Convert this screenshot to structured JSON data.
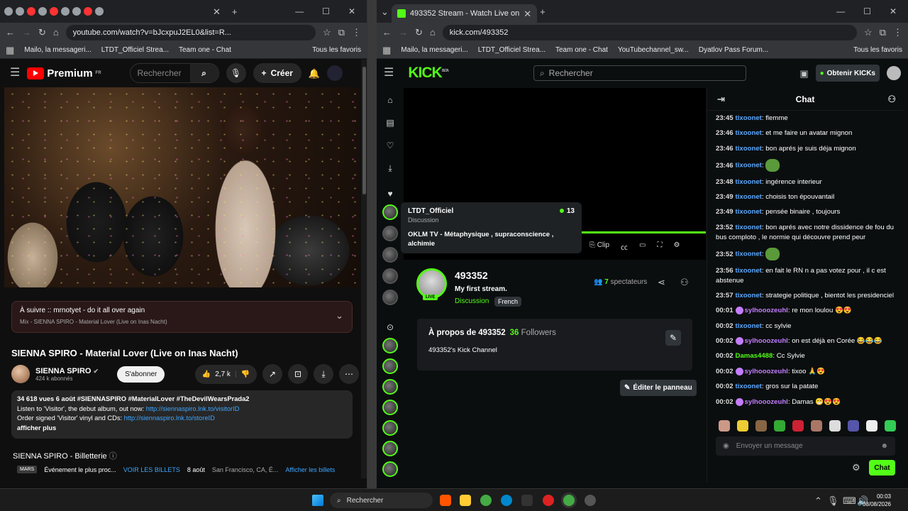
{
  "left": {
    "url": "youtube.com/watch?v=bJcxpuJ2EL0&list=R...",
    "bookmarks": [
      "Mailo, la messageri...",
      "LTDT_Officiel Strea...",
      "Team one - Chat",
      "Tous les favoris"
    ],
    "yt": {
      "logo": "Premium",
      "logo_region": "FR",
      "search_placeholder": "Rechercher",
      "create_label": "Créer",
      "next_title": "À suivre :: mrnotyet - do it all over again",
      "next_sub": "Mix - SIENNA SPIRO - Material Lover (Live on Inas Nacht)",
      "video_title": "SIENNA SPIRO - Material Lover (Live on Inas Nacht)",
      "channel": "SIENNA SPIRO",
      "subs": "424 k abonnés",
      "subscribe": "S'abonner",
      "likes": "2,7 k",
      "desc_meta": "34 618 vues  6 août  #SIENNASPIRO #MaterialLover #TheDevilWearsPrada2",
      "desc_l1": "Listen to 'Visitor', the debut album, out now: ",
      "desc_l1_link": "http://siennaspiro.lnk.to/visitorID",
      "desc_l2": "Order signed 'Visitor' vinyl and CDs: ",
      "desc_l2_link": "http://siennaspiro.lnk.to/storeID",
      "desc_more": "afficher plus",
      "tickets_heading": "SIENNA SPIRO - Billetterie",
      "ticket_month": "MARS",
      "ticket_event": "Événement le plus proc...",
      "ticket_link": "VOIR LES BILLETS",
      "ticket_date": "8 août",
      "ticket_place": "San Francisco, CA, É...",
      "ticket_all": "Afficher les billets"
    }
  },
  "right": {
    "tab_title": "493352 Stream - Watch Live on",
    "url": "kick.com/493352",
    "bookmarks": [
      "Mailo, la messageri...",
      "LTDT_Officiel Strea...",
      "Team one - Chat",
      "YouTubechannel_sw...",
      "Dyatlov Pass Forum...",
      "Tous les favoris"
    ],
    "kick": {
      "logo": "KICK",
      "logo_badge": "BETA",
      "search_placeholder": "Rechercher",
      "get_kicks": "Obtenir KICKs",
      "tooltip": {
        "name": "LTDT_Officiel",
        "category": "Discussion",
        "viewers": "13",
        "title": "OKLM TV - Métaphysique , supraconscience , alchimie"
      },
      "controls": {
        "clip": "Clip"
      },
      "channel": "493352",
      "live": "LIVE",
      "stream_title": "My first stream.",
      "category": "Discussion",
      "language": "French",
      "viewers_count": "7",
      "viewers_label": "spectateurs",
      "about_prefix": "À propos de 493352",
      "followers_count": "36",
      "followers_label": "Followers",
      "about_desc": "493352's Kick Channel",
      "edit_panel": "Éditer le panneau",
      "chat_title": "Chat",
      "chat_placeholder": "Envoyer un message",
      "chat_button": "Chat",
      "messages": [
        {
          "time": "23:45",
          "user": "tixoonet",
          "text": "flemme",
          "cls": "u1"
        },
        {
          "time": "23:46",
          "user": "tixoonet",
          "text": "et me faire un avatar mignon",
          "cls": "u1"
        },
        {
          "time": "23:46",
          "user": "tixoonet",
          "text": "bon aprés je suis déja mignon",
          "cls": "u1"
        },
        {
          "time": "23:46",
          "user": "tixoonet",
          "text": "",
          "cls": "u1",
          "emote": true
        },
        {
          "time": "23:48",
          "user": "tixoonet",
          "text": "ingérence interieur",
          "cls": "u1"
        },
        {
          "time": "23:49",
          "user": "tixoonet",
          "text": "choisis ton épouvantail",
          "cls": "u1"
        },
        {
          "time": "23:49",
          "user": "tixoonet",
          "text": "pensée binaire , toujours",
          "cls": "u1"
        },
        {
          "time": "23:52",
          "user": "tixoonet",
          "text": "bon aprés avec notre dissidence de fou du bus comploto , le normie qui découvre prend peur",
          "cls": "u1"
        },
        {
          "time": "23:52",
          "user": "tixoonet",
          "text": "",
          "cls": "u1",
          "emote": true
        },
        {
          "time": "23:56",
          "user": "tixoonet",
          "text": "en fait le RN n a pas votez pour , il c est abstenue",
          "cls": "u1"
        },
        {
          "time": "23:57",
          "user": "tixoonet",
          "text": "strategie politique , bientot les presidenciel",
          "cls": "u1"
        },
        {
          "time": "00:01",
          "user": "sylhooozeuhl",
          "text": "re mon loulou 😍😍",
          "cls": "u2",
          "badge": true
        },
        {
          "time": "00:02",
          "user": "tixoonet",
          "text": "cc sylvie",
          "cls": "u1"
        },
        {
          "time": "00:02",
          "user": "sylhooozeuhl",
          "text": "on est déjà en Corée 😂😂😂",
          "cls": "u2",
          "badge": true
        },
        {
          "time": "00:02",
          "user": "Damas4488",
          "text": "Cc Sylvie",
          "cls": "u3"
        },
        {
          "time": "00:02",
          "user": "sylhooozeuhl",
          "text": "tixoo 🙏😍",
          "cls": "u2",
          "badge": true
        },
        {
          "time": "00:02",
          "user": "tixoonet",
          "text": "gros sur la patate",
          "cls": "u1"
        },
        {
          "time": "00:02",
          "user": "sylhooozeuhl",
          "text": "Damas 😁😍😍",
          "cls": "u2",
          "badge": true
        }
      ]
    }
  },
  "taskbar": {
    "search": "Rechercher",
    "time": "00:03",
    "date": "08/08/2026"
  }
}
